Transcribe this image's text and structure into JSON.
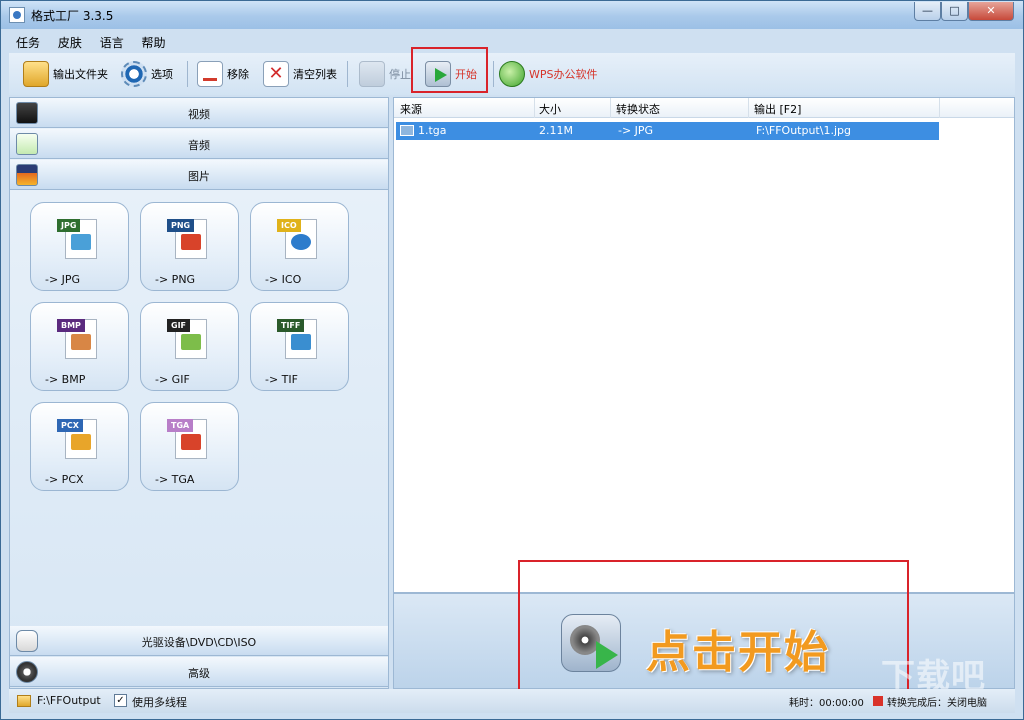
{
  "window": {
    "title": "格式工厂 3.3.5",
    "min": "—",
    "max": "□",
    "close": "✕"
  },
  "menu": [
    "任务",
    "皮肤",
    "语言",
    "帮助"
  ],
  "toolbar": {
    "output_folder": "输出文件夹",
    "options": "选项",
    "remove": "移除",
    "clear_list": "清空列表",
    "stop": "停止",
    "start": "开始",
    "wps": "WPS办公软件"
  },
  "categories": {
    "video": "视频",
    "audio": "音频",
    "image": "图片",
    "dvd": "光驱设备\\DVD\\CD\\ISO",
    "advanced": "高级"
  },
  "tiles": [
    {
      "tag": "JPG",
      "label": "-> JPG",
      "tag_color": "#2f6e2f",
      "pic_color": "#4aa0d8"
    },
    {
      "tag": "PNG",
      "label": "-> PNG",
      "tag_color": "#1f4f89",
      "pic_color": "#d8432a"
    },
    {
      "tag": "ICO",
      "label": "-> ICO",
      "tag_color": "#e0b21a",
      "pic_color": "#2d7ccc"
    },
    {
      "tag": "BMP",
      "label": "-> BMP",
      "tag_color": "#5b2a7e",
      "pic_color": "#d88645"
    },
    {
      "tag": "GIF",
      "label": "-> GIF",
      "tag_color": "#222222",
      "pic_color": "#7dbd4a"
    },
    {
      "tag": "TIFF",
      "label": "-> TIF",
      "tag_color": "#2b5a2b",
      "pic_color": "#3a8ed0"
    },
    {
      "tag": "PCX",
      "label": "-> PCX",
      "tag_color": "#2e67b4",
      "pic_color": "#e8a52a"
    },
    {
      "tag": "TGA",
      "label": "-> TGA",
      "tag_color": "#b87ec8",
      "pic_color": "#d8432a"
    }
  ],
  "list": {
    "headers": [
      "来源",
      "大小",
      "转换状态",
      "输出 [F2]"
    ],
    "rows": [
      {
        "source": "1.tga",
        "size": "2.11M",
        "status": "-> JPG",
        "output": "F:\\FFOutput\\1.jpg"
      }
    ]
  },
  "start_area": {
    "text": "点击开始"
  },
  "watermark": "下载吧",
  "status": {
    "path": "F:\\FFOutput",
    "multithread_checked": "✓",
    "multithread_label": "使用多线程",
    "elapsed": "耗时：00:00:00",
    "after_label": "转换完成后：关闭电脑"
  },
  "colors": {
    "accent_red": "#d9232a",
    "selection_blue": "#3d8ee2",
    "start_orange": "#f29a1f"
  }
}
